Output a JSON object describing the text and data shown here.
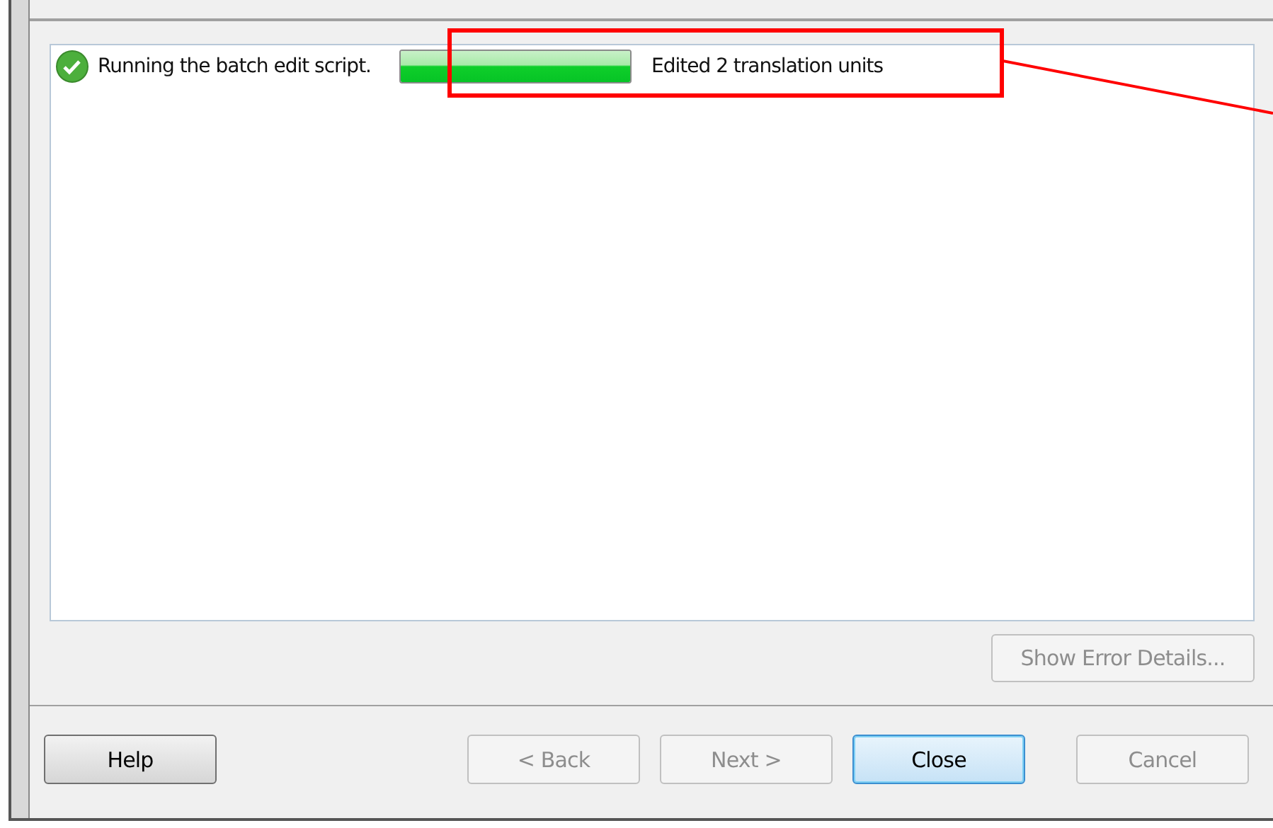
{
  "log": [
    {
      "done": true,
      "message": "Running the batch edit script.",
      "progress": {
        "level": 1
      },
      "result": "Edited 2 translation units"
    }
  ],
  "show_error_details": {
    "label": "Show Error Details...",
    "disabled": true
  },
  "buttons": [
    {
      "label": "Help",
      "disabled": false,
      "default": false
    },
    {
      "label": "< Back",
      "disabled": true,
      "default": false
    },
    {
      "label": "Next >",
      "disabled": true,
      "default": false
    },
    {
      "label": "Close",
      "disabled": false,
      "default": true
    },
    {
      "label": "Cancel",
      "disabled": true,
      "default": false
    }
  ],
  "annotation": {
    "kind": "highlight",
    "color": "#ff0000"
  }
}
